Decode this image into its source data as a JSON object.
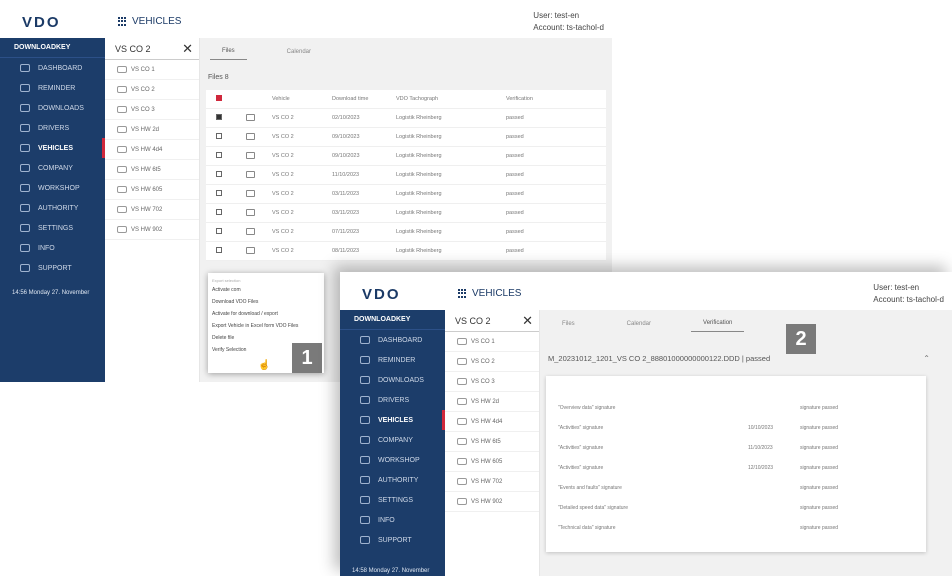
{
  "app": {
    "logo": "VDO",
    "title": "VEHICLES",
    "user_line": "User: test-en",
    "account_line": "Account: ts-tachol-d"
  },
  "sidebar": {
    "header": "DOWNLOADKEY",
    "items": [
      {
        "label": "DASHBOARD",
        "icon": "dashboard-icon"
      },
      {
        "label": "REMINDER",
        "icon": "bell-icon"
      },
      {
        "label": "DOWNLOADS",
        "icon": "download-icon"
      },
      {
        "label": "DRIVERS",
        "icon": "driver-icon"
      },
      {
        "label": "VEHICLES",
        "icon": "truck-icon",
        "active": true
      },
      {
        "label": "COMPANY",
        "icon": "company-icon"
      },
      {
        "label": "WORKSHOP",
        "icon": "workshop-icon"
      },
      {
        "label": "AUTHORITY",
        "icon": "authority-icon"
      },
      {
        "label": "SETTINGS",
        "icon": "gear-icon"
      },
      {
        "label": "INFO",
        "icon": "info-icon"
      },
      {
        "label": "SUPPORT",
        "icon": "support-icon"
      }
    ],
    "footer_1": "14:56 Monday 27. November",
    "footer_2": "14:58 Monday 27. November"
  },
  "search": {
    "value": "VS CO 2"
  },
  "vehicles_1": [
    "VS CO 1",
    "VS CO 2",
    "VS CO 3",
    "VS HW 2d",
    "VS HW 4d4",
    "VS HW 6t5",
    "VS HW 605",
    "VS HW 702",
    "VS HW 902"
  ],
  "vehicles_2": [
    "VS CO 1",
    "VS CO 2",
    "VS CO 3",
    "VS HW 2d",
    "VS HW 4d4",
    "VS HW 6t5",
    "VS HW 605",
    "VS HW 702",
    "VS HW 902"
  ],
  "tabs_1": [
    "Files",
    "Calendar"
  ],
  "tabs_2": [
    "Files",
    "Calendar",
    "Verification"
  ],
  "files": {
    "title": "Files 8",
    "columns": [
      "Vehicle",
      "Download time",
      "VDO Tachograph",
      "Verification"
    ],
    "rows": [
      {
        "vehicle": "VS CO 2",
        "date": "02/10/2023",
        "desc": "Logistik Rheinberg",
        "status": "passed"
      },
      {
        "vehicle": "VS CO 2",
        "date": "09/10/2023",
        "desc": "Logistik Rheinberg",
        "status": "passed"
      },
      {
        "vehicle": "VS CO 2",
        "date": "09/10/2023",
        "desc": "Logistik Rheinberg",
        "status": "passed"
      },
      {
        "vehicle": "VS CO 2",
        "date": "11/10/2023",
        "desc": "Logistik Rheinberg",
        "status": "passed"
      },
      {
        "vehicle": "VS CO 2",
        "date": "03/11/2023",
        "desc": "Logistik Rheinberg",
        "status": "passed"
      },
      {
        "vehicle": "VS CO 2",
        "date": "03/11/2023",
        "desc": "Logistik Rheinberg",
        "status": "passed"
      },
      {
        "vehicle": "VS CO 2",
        "date": "07/11/2023",
        "desc": "Logistik Rheinberg",
        "status": "passed"
      },
      {
        "vehicle": "VS CO 2",
        "date": "08/11/2023",
        "desc": "Logistik Rheinberg",
        "status": "passed"
      }
    ]
  },
  "context_menu": {
    "hint": "Export selection",
    "items": [
      "Activate com",
      "Download VDO Files",
      "Activate for download / export",
      "Export Vehicle in Excel form VDO Files",
      "Delete file",
      "Verify Selection"
    ]
  },
  "verification": {
    "title": "M_20231012_1201_VS CO 2_88801000000000122.DDD | passed",
    "rows": [
      {
        "label": "\"Overview data\" signature",
        "date": "",
        "status": "signature passed"
      },
      {
        "label": "\"Activities\" signature",
        "date": "10/10/2023",
        "status": "signature passed"
      },
      {
        "label": "\"Activities\" signature",
        "date": "11/10/2023",
        "status": "signature passed"
      },
      {
        "label": "\"Activities\" signature",
        "date": "12/10/2023",
        "status": "signature passed"
      },
      {
        "label": "\"Events and faults\" signature",
        "date": "",
        "status": "signature passed"
      },
      {
        "label": "\"Detailed speed data\" signature",
        "date": "",
        "status": "signature passed"
      },
      {
        "label": "\"Technical data\" signature",
        "date": "",
        "status": "signature passed"
      }
    ]
  },
  "callouts": [
    "1",
    "2"
  ]
}
